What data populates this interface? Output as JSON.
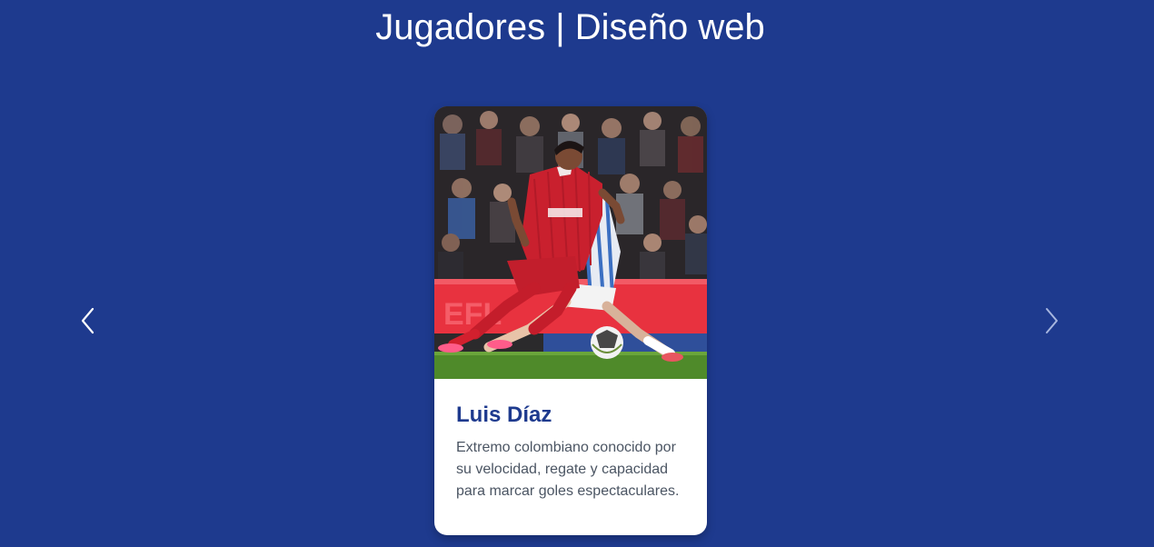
{
  "header": {
    "title": "Jugadores | Diseño web"
  },
  "carousel": {
    "prev_icon": "chevron-left-icon",
    "next_icon": "chevron-right-icon",
    "card": {
      "name": "Luis Díaz",
      "description": "Extremo colombiano conocido por su velocidad, regate y capacidad para marcar goles espectaculares."
    }
  },
  "colors": {
    "background": "#1e3a8e",
    "accent": "#1e3a8e",
    "card": "#ffffff",
    "text_muted": "#4b5563"
  }
}
